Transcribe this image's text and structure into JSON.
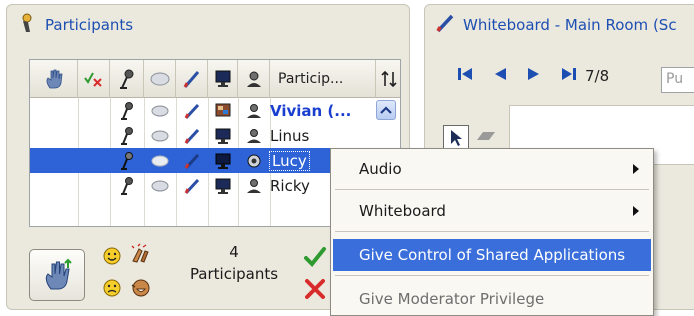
{
  "participants_panel": {
    "title": "Participants",
    "name_column_header": "Particip...",
    "rows": [
      {
        "name": "Vivian (...",
        "host": true,
        "selected": false
      },
      {
        "name": "Linus",
        "host": false,
        "selected": false
      },
      {
        "name": "Lucy",
        "host": false,
        "selected": true
      },
      {
        "name": "Ricky",
        "host": false,
        "selected": false
      }
    ],
    "count": "4",
    "count_label": "Participants"
  },
  "whiteboard_panel": {
    "title": "Whiteboard - Main Room (Sc",
    "page_indicator": "7/8",
    "pages_field_text": "Pu"
  },
  "context_menu": {
    "items": [
      {
        "label": "Audio",
        "submenu": true
      },
      {
        "label": "Whiteboard",
        "submenu": true
      },
      {
        "label": "Give Control of Shared Applications",
        "highlighted": true
      },
      {
        "label": "Give Moderator Privilege",
        "disabled": true
      }
    ]
  },
  "colors": {
    "title_blue": "#1d4fb2",
    "selection_blue": "#2d63d6",
    "menu_highlight": "#3a6fdb",
    "panel_bg": "#ebe9de"
  }
}
